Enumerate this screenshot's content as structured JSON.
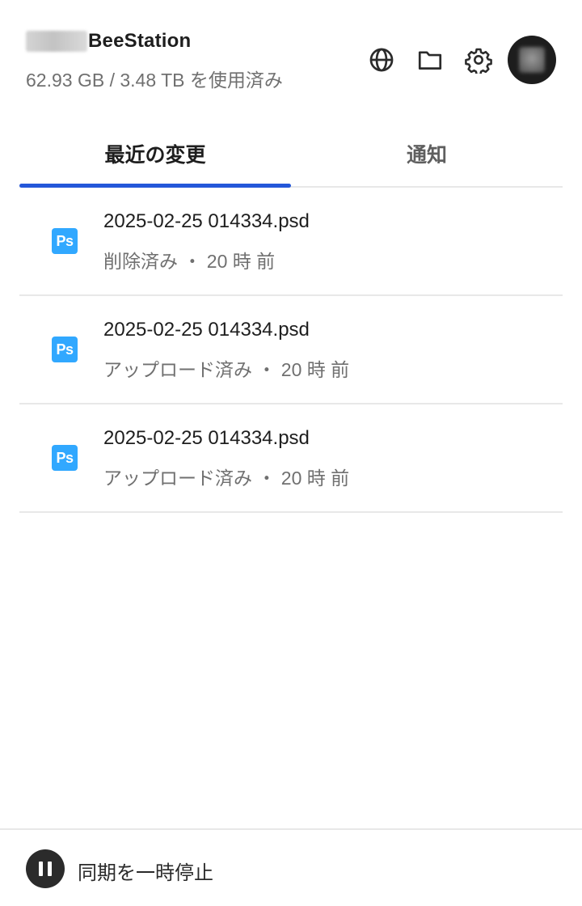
{
  "header": {
    "device_title": "BeeStation",
    "usage_text": "62.93 GB / 3.48 TB を使用済み",
    "icons": [
      "globe-icon",
      "folder-icon",
      "gear-icon"
    ]
  },
  "tabs": [
    {
      "label": "最近の変更",
      "active": true
    },
    {
      "label": "通知",
      "active": false
    }
  ],
  "recent_changes": [
    {
      "file_icon": "Ps",
      "name": "2025-02-25 014334.psd",
      "status": "削除済み ・ 20 時 前"
    },
    {
      "file_icon": "Ps",
      "name": "2025-02-25 014334.psd",
      "status": "アップロード済み ・ 20 時 前"
    },
    {
      "file_icon": "Ps",
      "name": "2025-02-25 014334.psd",
      "status": "アップロード済み ・ 20 時 前"
    }
  ],
  "footer": {
    "pause_label": "同期を一時停止"
  },
  "colors": {
    "accent": "#2457d9",
    "ps_icon": "#31a8ff",
    "secondary_text": "#707070"
  }
}
